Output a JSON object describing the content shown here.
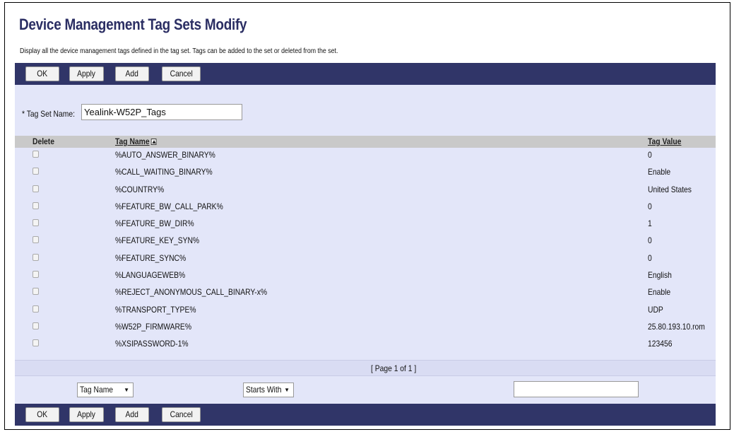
{
  "page": {
    "title": "Device Management Tag Sets Modify",
    "description": "Display all the device management tags defined in the tag set. Tags can be added to the set or deleted from the set."
  },
  "toolbar": {
    "ok_label": "OK",
    "apply_label": "Apply",
    "add_label": "Add",
    "cancel_label": "Cancel"
  },
  "form": {
    "tag_set_name_label": "* Tag Set Name:",
    "tag_set_name_value": "Yealink-W52P_Tags"
  },
  "table": {
    "headers": {
      "delete": "Delete",
      "tag_name": "Tag Name",
      "tag_value": "Tag Value"
    },
    "sort_icon": "sort-ascending-icon",
    "rows": [
      {
        "name": "%AUTO_ANSWER_BINARY%",
        "value": "0"
      },
      {
        "name": "%CALL_WAITING_BINARY%",
        "value": "Enable"
      },
      {
        "name": "%COUNTRY%",
        "value": "United States"
      },
      {
        "name": "%FEATURE_BW_CALL_PARK%",
        "value": "0"
      },
      {
        "name": "%FEATURE_BW_DIR%",
        "value": "1"
      },
      {
        "name": "%FEATURE_KEY_SYN%",
        "value": "0"
      },
      {
        "name": "%FEATURE_SYNC%",
        "value": "0"
      },
      {
        "name": "%LANGUAGEWEB%",
        "value": "English"
      },
      {
        "name": "%REJECT_ANONYMOUS_CALL_BINARY-x%",
        "value": "Enable"
      },
      {
        "name": "%TRANSPORT_TYPE%",
        "value": "UDP"
      },
      {
        "name": "%W52P_FIRMWARE%",
        "value": "25.80.193.10.rom"
      },
      {
        "name": "%XSIPASSWORD-1%",
        "value": "123456"
      }
    ],
    "pager": "[ Page 1 of 1 ]"
  },
  "search": {
    "field_select": "Tag Name",
    "mode_select": "Starts With",
    "query": ""
  },
  "colors": {
    "toolbar_bg": "#303568",
    "panel_bg": "#e3e6f9",
    "header_bg": "#c9c9c9",
    "title_color": "#2b2e63"
  }
}
